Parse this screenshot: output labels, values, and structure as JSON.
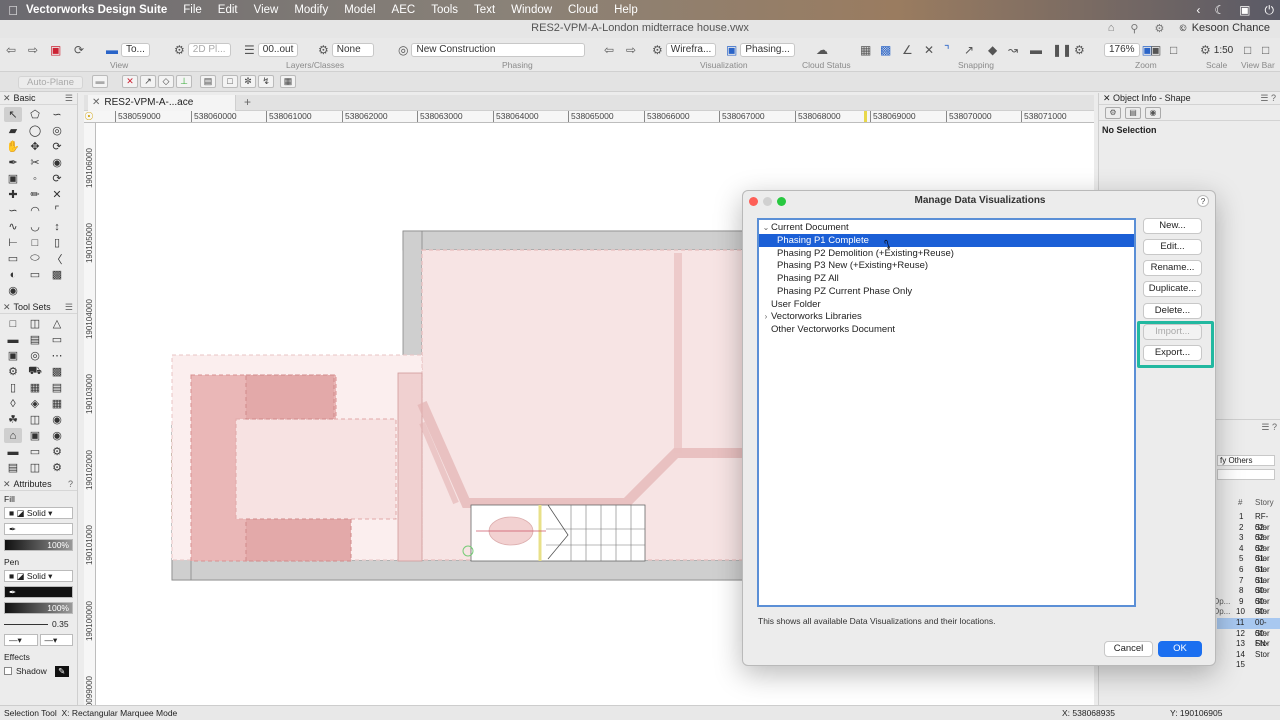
{
  "menubar": {
    "app": "Vectorworks Design Suite",
    "items": [
      "File",
      "Edit",
      "View",
      "Modify",
      "Model",
      "AEC",
      "Tools",
      "Text",
      "Window",
      "Cloud",
      "Help"
    ]
  },
  "titlebar": {
    "title": "RES2-VPM-A-London midterrace house.vwx",
    "user": "Kesoon Chance"
  },
  "toolbar": {
    "view_sel": "To...",
    "plane_sel": "2D Pl...",
    "layer_sel": "00..out",
    "class_sel": "None",
    "phase_sel": "New Construction",
    "render_sel": "Wirefra...",
    "datavis_sel": "Phasing...",
    "zoom_value": "176%",
    "scale_value": "1:50",
    "labels": {
      "view": "View",
      "layers": "Layers/Classes",
      "phasing": "Phasing",
      "visualization": "Visualization",
      "cloud": "Cloud Status",
      "snapping": "Snapping",
      "zoom": "Zoom",
      "scale": "Scale",
      "viewbar": "View Bar"
    }
  },
  "toolbar2": {
    "autoplane": "Auto-Plane"
  },
  "palette": {
    "basic_title": "Basic",
    "toolsets_title": "Tool Sets",
    "attributes_title": "Attributes",
    "fill_label": "Fill",
    "fill_style": "Solid",
    "fill_opacity": "100%",
    "pen_label": "Pen",
    "pen_style": "Solid",
    "pen_opacity": "100%",
    "line_weight": "0.35",
    "effects_label": "Effects",
    "shadow_label": "Shadow"
  },
  "document": {
    "tab_label": "RES2-VPM-A-...ace house.vwx",
    "ruler_h": [
      "538059000",
      "538060000",
      "538061000",
      "538062000",
      "538063000",
      "538064000",
      "538065000",
      "538066000",
      "538067000",
      "538068000",
      "538069000",
      "538070000",
      "538071000"
    ],
    "ruler_v": [
      "190106000",
      "190105000",
      "190104000",
      "190103000",
      "190102000",
      "190101000",
      "190100000",
      "190099000"
    ]
  },
  "objinfo": {
    "title": "Object Info - Shape",
    "no_selection": "No Selection",
    "others_sel": "fy Others",
    "story_header_num": "#",
    "story_header": "Story",
    "stories": [
      {
        "n": "1",
        "s": "RF-Stor",
        "left": ""
      },
      {
        "n": "2",
        "s": "02-Stor",
        "left": ""
      },
      {
        "n": "3",
        "s": "02-Stor",
        "left": ""
      },
      {
        "n": "4",
        "s": "02-Stor",
        "left": ""
      },
      {
        "n": "5",
        "s": "01-Stor",
        "left": ""
      },
      {
        "n": "6",
        "s": "01-Stor",
        "left": ""
      },
      {
        "n": "7",
        "s": "01-Stor",
        "left": ""
      },
      {
        "n": "8",
        "s": "00-Stor",
        "left": ""
      },
      {
        "n": "9",
        "s": "00-Stor",
        "left": "Op..."
      },
      {
        "n": "10",
        "s": "00-Stor",
        "left": "Op..."
      },
      {
        "n": "11",
        "s": "00-Stor",
        "left": ""
      },
      {
        "n": "12",
        "s": "00-Stor",
        "left": ""
      },
      {
        "n": "13",
        "s": "FN-Stor",
        "left": ""
      },
      {
        "n": "14",
        "s": "",
        "left": ""
      },
      {
        "n": "15",
        "s": "",
        "left": ""
      }
    ]
  },
  "dialog": {
    "title": "Manage Data Visualizations",
    "help": "?",
    "items": [
      {
        "label": "Current Document",
        "indent": 0,
        "disclosure": "down",
        "selected": false
      },
      {
        "label": "Phasing P1 Complete",
        "indent": 1,
        "disclosure": "",
        "selected": true
      },
      {
        "label": "Phasing P2 Demolition (+Existing+Reuse)",
        "indent": 1,
        "disclosure": "",
        "selected": false
      },
      {
        "label": "Phasing P3 New (+Existing+Reuse)",
        "indent": 1,
        "disclosure": "",
        "selected": false
      },
      {
        "label": "Phasing PZ All",
        "indent": 1,
        "disclosure": "",
        "selected": false
      },
      {
        "label": "Phasing PZ Current Phase Only",
        "indent": 1,
        "disclosure": "",
        "selected": false
      },
      {
        "label": "User Folder",
        "indent": 0,
        "disclosure": "",
        "selected": false
      },
      {
        "label": "Vectorworks Libraries",
        "indent": 0,
        "disclosure": "right",
        "selected": false
      },
      {
        "label": "Other Vectorworks Document",
        "indent": 0,
        "disclosure": "",
        "selected": false
      }
    ],
    "buttons": {
      "new": "New...",
      "edit": "Edit...",
      "rename": "Rename...",
      "duplicate": "Duplicate...",
      "delete": "Delete...",
      "import": "Import...",
      "export": "Export..."
    },
    "note": "This shows all available Data Visualizations and their locations.",
    "cancel": "Cancel",
    "ok": "OK",
    "highlight_color": "#22b8a0",
    "selection_color": "#1b5fd6"
  },
  "statusbar": {
    "tool": "Selection Tool",
    "mode": "X:  Rectangular Marquee Mode",
    "x": "X: 538068935",
    "y": "Y: 190106905"
  }
}
